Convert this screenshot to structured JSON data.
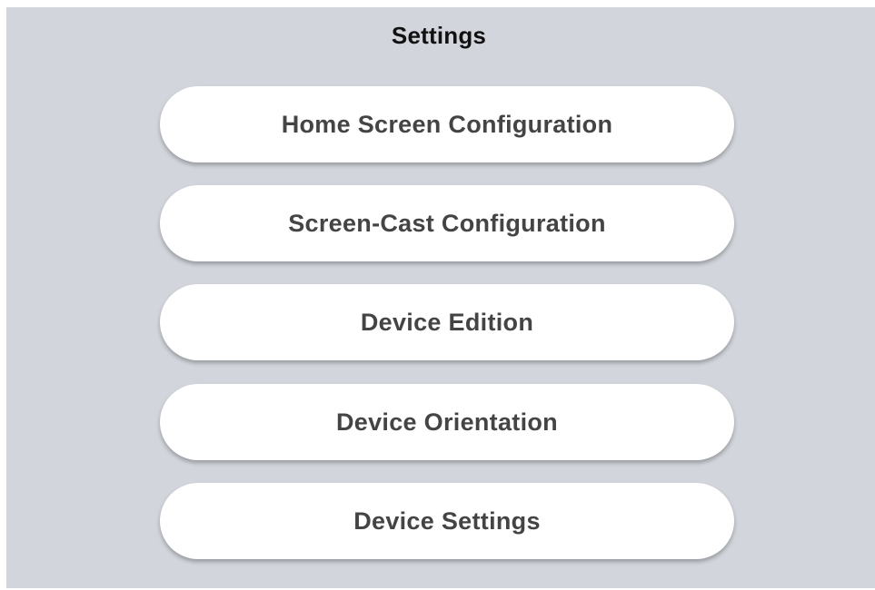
{
  "header": {
    "title": "Settings"
  },
  "menu": {
    "items": [
      {
        "label": "Home Screen Configuration"
      },
      {
        "label": "Screen-Cast Configuration"
      },
      {
        "label": "Device Edition"
      },
      {
        "label": "Device Orientation"
      },
      {
        "label": "Device Settings"
      }
    ]
  },
  "colors": {
    "background": "#d2d6dc",
    "button": "#ffffff",
    "title_text": "#111111",
    "button_text": "#444444"
  }
}
